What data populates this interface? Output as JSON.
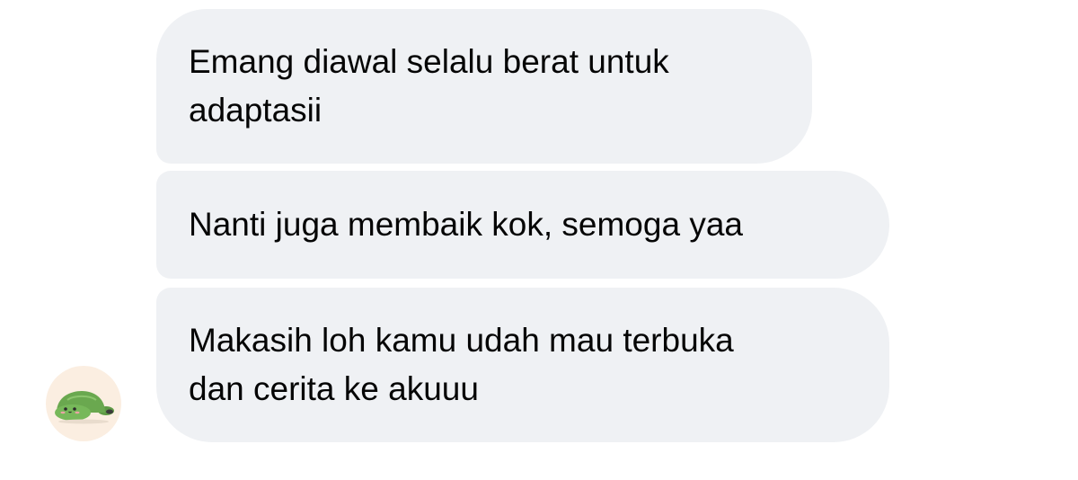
{
  "conversation": {
    "messages": [
      {
        "lines": [
          "Emang diawal selalu berat untuk",
          "adaptasii"
        ]
      },
      {
        "lines": [
          "Nanti juga membaik kok, semoga yaa"
        ]
      },
      {
        "lines": [
          "Makasih loh kamu udah mau terbuka",
          "dan cerita ke akuuu"
        ]
      }
    ],
    "sender": {
      "avatar_icon": "turtle-icon"
    },
    "colors": {
      "bubble": "#eff1f4",
      "text": "#050505",
      "avatar_bg": "#fbeee1",
      "turtle_green": "#6aa84f"
    }
  }
}
